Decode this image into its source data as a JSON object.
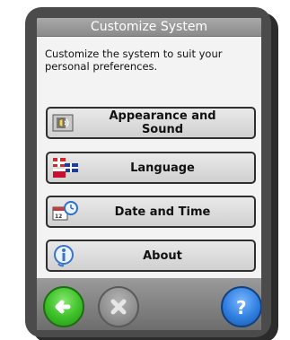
{
  "window": {
    "title": "Customize System"
  },
  "description": "Customize the system to suit your personal preferences.",
  "menu": {
    "items": [
      {
        "label": "Appearance and Sound",
        "icon": "speaker-icon"
      },
      {
        "label": "Language",
        "icon": "flags-icon"
      },
      {
        "label": "Date and Time",
        "icon": "calendar-clock-icon"
      },
      {
        "label": "About",
        "icon": "info-icon"
      }
    ]
  },
  "bottom_bar": {
    "back": "back-arrow-icon",
    "cancel": "close-icon",
    "help": "help-icon"
  }
}
